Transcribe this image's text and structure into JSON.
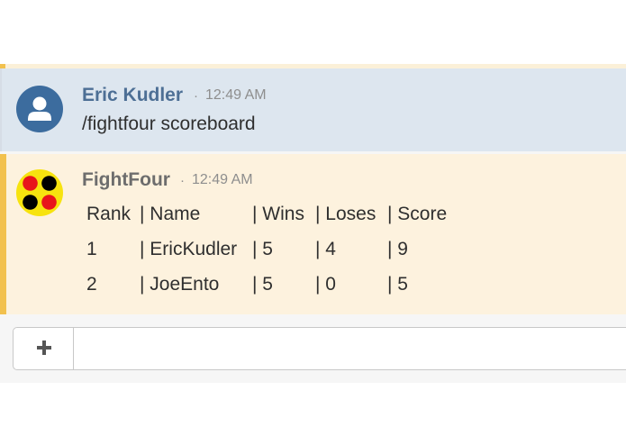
{
  "messages": [
    {
      "sender": "Eric Kudler",
      "separator": "·",
      "time": "12:49 AM",
      "text": "/fightfour scoreboard",
      "avatar_icon": "user-silhouette-icon"
    },
    {
      "sender": "FightFour",
      "separator": "·",
      "time": "12:49 AM",
      "avatar_icon": "four-dots-logo-icon",
      "table": {
        "header": [
          "Rank",
          "| Name",
          "| Wins",
          "| Loses",
          "| Score"
        ],
        "rows": [
          [
            "1",
            "| EricKudler",
            "| 5",
            "| 4",
            "| 9"
          ],
          [
            "2",
            "| JoeEnto",
            "| 5",
            "| 0",
            "| 5"
          ]
        ]
      }
    }
  ],
  "composer": {
    "add_icon": "plus-icon"
  },
  "colors": {
    "user_message_bg": "#dde6ef",
    "bot_message_bg": "#fdf2de",
    "bot_accent": "#f2c14e",
    "user_name": "#4d6f95",
    "logo_red": "#e8141b",
    "logo_yellow": "#f7e30f"
  }
}
